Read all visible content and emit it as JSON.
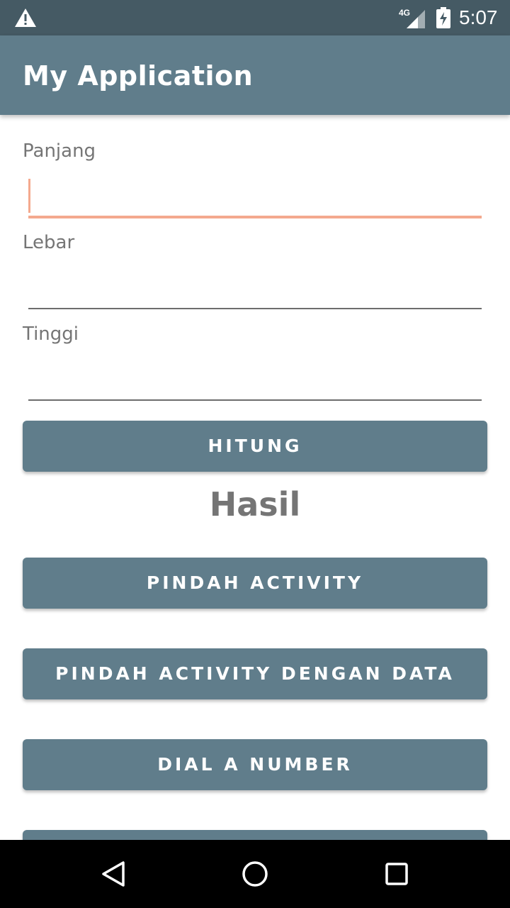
{
  "status_bar": {
    "time": "5:07",
    "network": "4G",
    "icons": [
      "warning-icon",
      "signal-icon",
      "battery-charging-icon"
    ]
  },
  "app_bar": {
    "title": "My Application"
  },
  "form": {
    "fields": [
      {
        "label": "Panjang",
        "value": "",
        "focused": true
      },
      {
        "label": "Lebar",
        "value": ""
      },
      {
        "label": "Tinggi",
        "value": ""
      }
    ],
    "calculate_label": "HITUNG",
    "result_text": "Hasil"
  },
  "buttons": {
    "move_activity": "PINDAH ACTIVITY",
    "move_activity_data": "PINDAH ACTIVITY DENGAN DATA",
    "dial_number": "DIAL A NUMBER"
  },
  "nav_bar": {
    "icons": [
      "back-icon",
      "home-icon",
      "recents-icon"
    ]
  },
  "colors": {
    "status_bar": "#455a64",
    "primary": "#607d8b",
    "accent": "#f4a98e",
    "text_secondary": "#757575"
  }
}
